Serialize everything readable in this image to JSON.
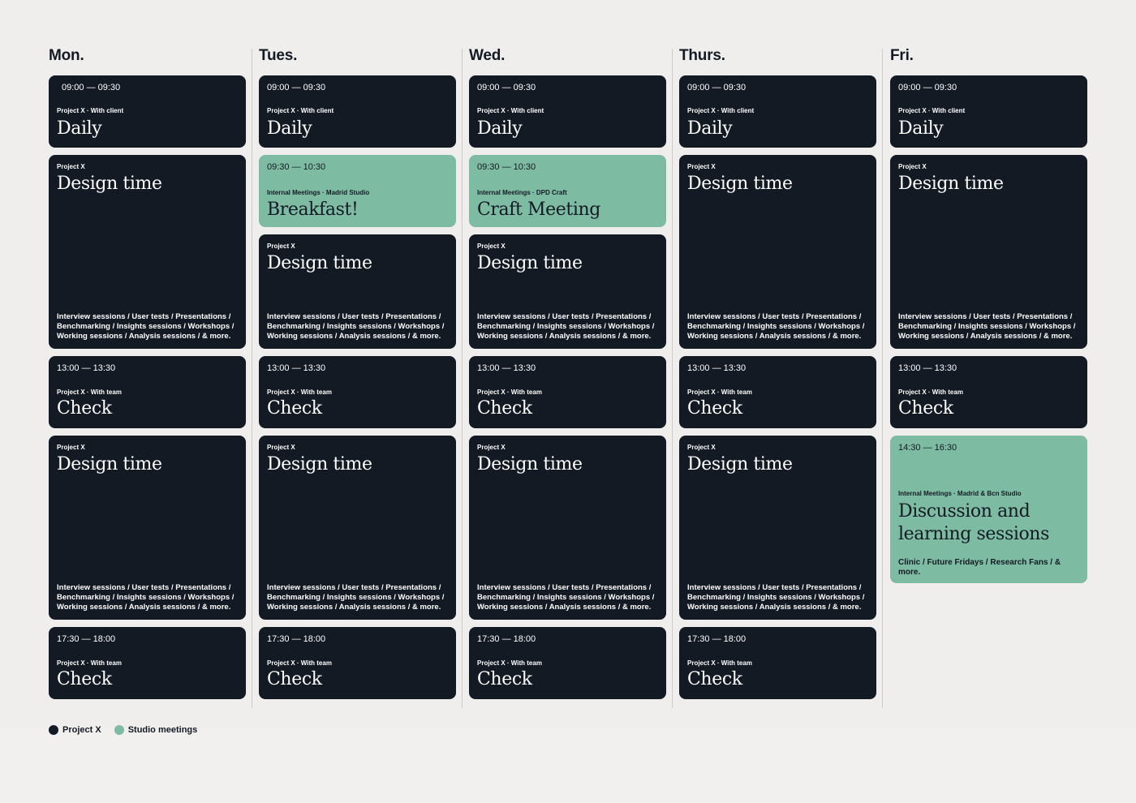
{
  "legend": {
    "project_x": {
      "label": "Project X",
      "color": "#141a24"
    },
    "studio": {
      "label": "Studio meetings",
      "color": "#7dbba3"
    }
  },
  "common": {
    "daily_time": "09:00 — 09:30",
    "daily_meta": "Project X · With client",
    "daily_title": "Daily",
    "design_meta": "Project X",
    "design_title": "Design time",
    "design_desc": "Interview sessions / User tests / Presentations / Benchmarking / Insights sessions / Workshops / Working sessions / Analysis sessions / & more.",
    "check_meta": "Project X · With team",
    "check_title": "Check",
    "check1_time": "13:00 — 13:30",
    "check2_time": "17:30 — 18:00"
  },
  "days": {
    "mon": {
      "label": "Mon."
    },
    "tue": {
      "label": "Tues.",
      "breakfast": {
        "time": "09:30 — 10:30",
        "meta": "Internal Meetings · Madrid Studio",
        "title": "Breakfast!"
      }
    },
    "wed": {
      "label": "Wed.",
      "craft": {
        "time": "09:30 — 10:30",
        "meta": "Internal Meetings · DPD Craft",
        "title": "Craft Meeting"
      }
    },
    "thu": {
      "label": "Thurs."
    },
    "fri": {
      "label": "Fri.",
      "discussion": {
        "time": "14:30 — 16:30",
        "meta": "Internal Meetings · Madrid & Bcn Studio",
        "title": "Discussion and learning sessions",
        "desc": "Clinic / Future Fridays / Research Fans / & more."
      }
    }
  }
}
